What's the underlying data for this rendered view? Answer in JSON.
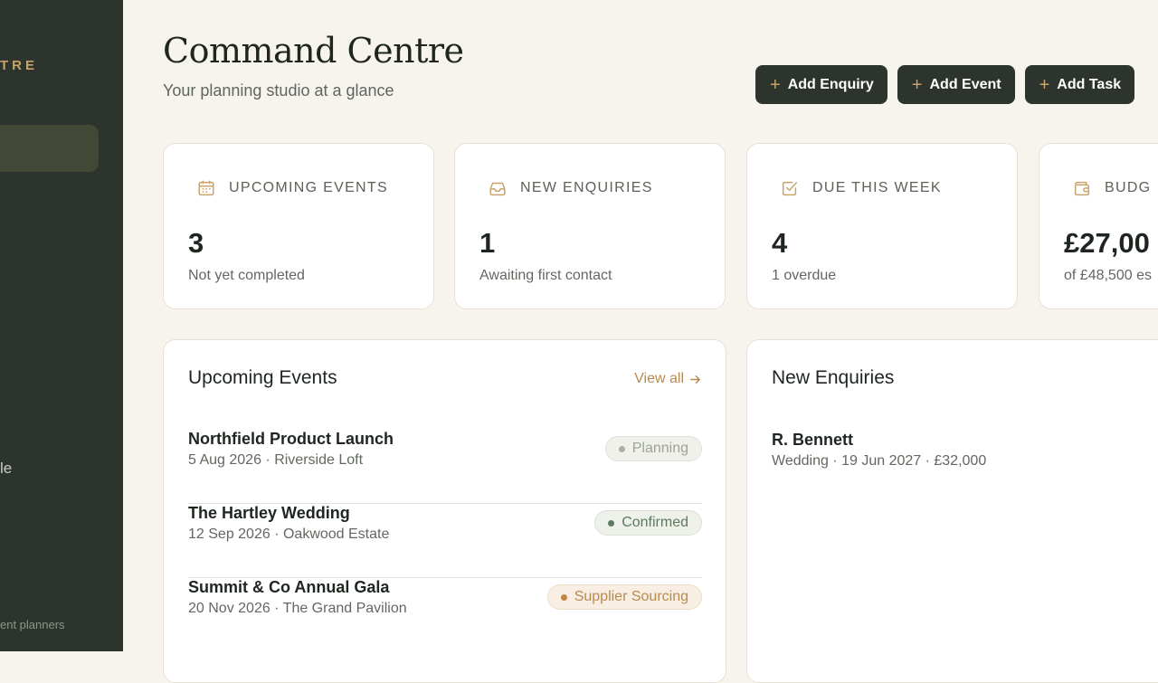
{
  "sidebar": {
    "brand": "TRE",
    "nav_item_partial": "le",
    "footer": "ent planners"
  },
  "header": {
    "title": "Command Centre",
    "subtitle": "Your planning studio at a glance"
  },
  "actions": [
    {
      "label": "Add Enquiry",
      "icon": "plus-icon"
    },
    {
      "label": "Add Event",
      "icon": "plus-icon"
    },
    {
      "label": "Add Task",
      "icon": "plus-icon"
    }
  ],
  "stats": [
    {
      "icon": "calendar-icon",
      "label": "UPCOMING EVENTS",
      "value": "3",
      "sub": "Not yet completed"
    },
    {
      "icon": "inbox-icon",
      "label": "NEW ENQUIRIES",
      "value": "1",
      "sub": "Awaiting first contact"
    },
    {
      "icon": "checkbox-icon",
      "label": "DUE THIS WEEK",
      "value": "4",
      "sub": "1 overdue"
    },
    {
      "icon": "wallet-icon",
      "label": "BUDG",
      "value": "£27,00",
      "sub": "of £48,500 es"
    }
  ],
  "upcoming_events": {
    "title": "Upcoming Events",
    "view_all": "View all",
    "rows": [
      {
        "name": "Northfield Product Launch",
        "meta": "5 Aug 2026 · Riverside Loft",
        "status": "Planning"
      },
      {
        "name": "The Hartley Wedding",
        "meta": "12 Sep 2026 · Oakwood Estate",
        "status": "Confirmed"
      },
      {
        "name": "Summit & Co Annual Gala",
        "meta": "20 Nov 2026 · The Grand Pavilion",
        "status": "Supplier Sourcing"
      }
    ]
  },
  "new_enquiries": {
    "title": "New Enquiries",
    "items": [
      {
        "name": "R. Bennett",
        "meta": "Wedding · 19 Jun 2027 · £32,000"
      }
    ]
  },
  "colors": {
    "sidebar": "#2c342d",
    "accent_gold": "#c8a36a",
    "planning": "#9aa595",
    "confirmed": "#5d7a5f",
    "supplier_sourcing": "#b88a4f"
  }
}
